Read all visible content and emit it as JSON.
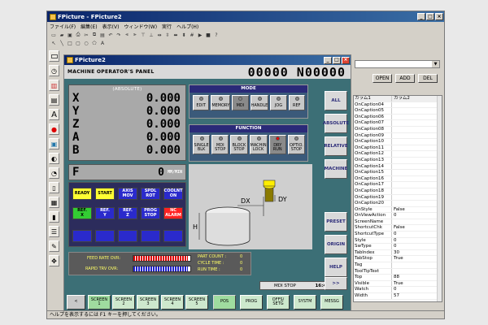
{
  "app": {
    "title": "FPicture - FPicture2",
    "menu": [
      "ファイル(F)",
      "編集(E)",
      "表示(V)",
      "ウィンドウ(W)",
      "実行",
      "ヘルプ(H)"
    ],
    "status": "ヘルプを表示するには F1 キーを押してください。"
  },
  "toolbar_icons": [
    "new-icon",
    "open-icon",
    "save-icon",
    "print-icon",
    "cut-icon",
    "copy-icon",
    "paste-icon",
    "undo-icon",
    "redo-icon",
    "align-left-icon",
    "align-right-icon",
    "align-top-icon",
    "align-bottom-icon",
    "center-h-icon",
    "center-v-icon",
    "same-width-icon",
    "same-height-icon",
    "grid-icon",
    "run-icon",
    "stop-icon",
    "help-icon"
  ],
  "draw_tools": [
    "pointer-icon",
    "line-icon",
    "rect-icon",
    "round-rect-icon",
    "ellipse-icon",
    "polygon-icon",
    "text-icon"
  ],
  "draw_tool_glyphs": [
    "↖",
    "╲",
    "□",
    "▢",
    "○",
    "⬠",
    "A"
  ],
  "child": {
    "title": "FPicture2",
    "panel_title": "MACHINE OPERATOR'S PANEL",
    "program_no": "00000 N00000",
    "abs_label": "(ABSOLUTE)",
    "axes": [
      {
        "axis": "X",
        "value": "0.000"
      },
      {
        "axis": "Y",
        "value": "0.000"
      },
      {
        "axis": "Z",
        "value": "0.000"
      },
      {
        "axis": "A",
        "value": "0.000"
      },
      {
        "axis": "B",
        "value": "0.000"
      }
    ],
    "mode": {
      "header": "MODE",
      "keys": [
        "EDIT",
        "MEMORY",
        "MDI",
        "HANDLE",
        "JOG",
        "REF"
      ],
      "selected": 2
    },
    "function": {
      "header": "FUNCTION",
      "keys": [
        "SINGLE\nBLK",
        "MDI\nSTOP",
        "BLOCK\nSTOP",
        "MACHIN\nLOCK",
        "DRY\nRUN",
        "OPTIO.\nSTOP"
      ],
      "lit": 4
    },
    "feed": {
      "letter": "F",
      "value": "0",
      "unit": "MM/MIN"
    },
    "status_keys": [
      {
        "label": "READY",
        "color": "#ffff33"
      },
      {
        "label": "START",
        "color": "#ffff33"
      },
      {
        "label": "AXIS\nMOV",
        "color": "#2a2acc",
        "text": "#fff"
      },
      {
        "label": "SPDL\nROT",
        "color": "#2a2acc",
        "text": "#fff"
      },
      {
        "label": "COOLNT\nON",
        "color": "#2a2acc",
        "text": "#fff"
      },
      {
        "label": "REF.\nX",
        "color": "#33cc33"
      },
      {
        "label": "REF.\nY",
        "color": "#2a2acc",
        "text": "#fff"
      },
      {
        "label": "REF.\nZ",
        "color": "#2a2acc",
        "text": "#fff"
      },
      {
        "label": "PROG\nSTOP",
        "color": "#2a2acc",
        "text": "#fff"
      },
      {
        "label": "NC\nALARM",
        "color": "#ff2222",
        "text": "#fff"
      }
    ],
    "side_buttons": [
      "ALL",
      "ABSOLUTE",
      "RELATIVE",
      "MACHINE",
      "PRESET",
      "ORIGIN",
      "HELP"
    ],
    "diagram": {
      "dx": "DX",
      "dy": "DY",
      "h": "H"
    },
    "overrides": {
      "feed_label": "FEED RATE OVR:",
      "feed_level": 0.95,
      "rapid_label": "RAPID TRV OVR:",
      "rapid_level": 0.95,
      "part_count_label": "PART COUNT :",
      "part_count": "0",
      "cycle_label": "CYCLE TIME :",
      "cycle_time": "0",
      "run_label": "RUN TIME :",
      "run_time": "0"
    },
    "mode_status": "MDI STOP",
    "time": "16:46",
    "next": ">>",
    "prev": "<",
    "screens": [
      {
        "label": "SCREEN\n1",
        "active": true
      },
      {
        "label": "SCREEN\n2",
        "active": false
      },
      {
        "label": "SCREEN\n3",
        "active": false
      },
      {
        "label": "SCREEN\n4",
        "active": false
      },
      {
        "label": "SCREEN\n5",
        "active": false
      }
    ],
    "fkeys": [
      "POS",
      "PROG",
      "OFFS/\nSETG",
      "SYSTM",
      "MESSG"
    ]
  },
  "props": {
    "buttons": [
      "OPEN",
      "ADD",
      "DEL"
    ],
    "col1": "カラム1",
    "col2": "カラム2",
    "rows": [
      [
        "OnCaption04",
        ""
      ],
      [
        "OnCaption05",
        ""
      ],
      [
        "OnCaption06",
        ""
      ],
      [
        "OnCaption07",
        ""
      ],
      [
        "OnCaption08",
        ""
      ],
      [
        "OnCaption09",
        ""
      ],
      [
        "OnCaption10",
        ""
      ],
      [
        "OnCaption11",
        ""
      ],
      [
        "OnCaption12",
        ""
      ],
      [
        "OnCaption13",
        ""
      ],
      [
        "OnCaption14",
        ""
      ],
      [
        "OnCaption15",
        ""
      ],
      [
        "OnCaption16",
        ""
      ],
      [
        "OnCaption17",
        ""
      ],
      [
        "OnCaption18",
        ""
      ],
      [
        "OnCaption19",
        ""
      ],
      [
        "OnCaption20",
        ""
      ],
      [
        "OnStyle",
        "False"
      ],
      [
        "OnViewAction",
        "0"
      ],
      [
        "ScreenName",
        ""
      ],
      [
        "ShortcutChk",
        "False"
      ],
      [
        "ShortcutType",
        "0"
      ],
      [
        "Style",
        "0"
      ],
      [
        "SwType",
        "0"
      ],
      [
        "TabIndex",
        "30"
      ],
      [
        "TabStop",
        "True"
      ],
      [
        "Tag",
        ""
      ],
      [
        "ToolTipText",
        ""
      ],
      [
        "Top",
        "88"
      ],
      [
        "Visible",
        "True"
      ],
      [
        "Watch",
        "0"
      ],
      [
        "Width",
        "57"
      ]
    ]
  }
}
